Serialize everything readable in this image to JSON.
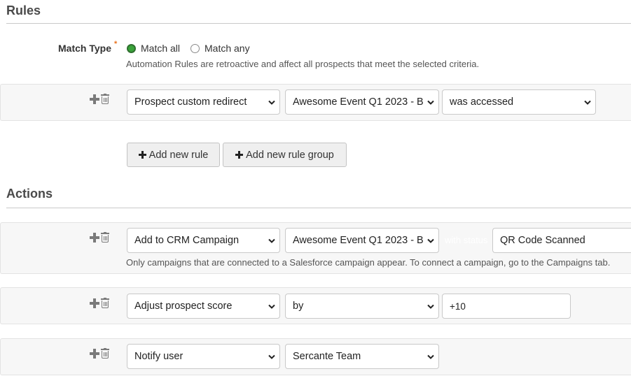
{
  "rules": {
    "title": "Rules",
    "match_type": {
      "label": "Match Type",
      "required_mark": "*",
      "options": [
        {
          "label": "Match all",
          "checked": true
        },
        {
          "label": "Match any",
          "checked": false
        }
      ],
      "help": "Automation Rules are retroactive and affect all prospects that meet the selected criteria."
    },
    "items": [
      {
        "criteria": "Prospect custom redirect",
        "target": "Awesome Event Q1 2023 - B",
        "condition": "was accessed"
      }
    ],
    "buttons": {
      "add_rule": "Add new rule",
      "add_rule_group": "Add new rule group"
    }
  },
  "actions": {
    "title": "Actions",
    "items": [
      {
        "action": "Add to CRM Campaign",
        "target": "Awesome Event Q1 2023 - B",
        "status_label": "with status",
        "status_value": "QR Code Scanned",
        "help": "Only campaigns that are connected to a Salesforce campaign appear. To connect a campaign, go to the Campaigns tab."
      },
      {
        "action": "Adjust prospect score",
        "operator": "by",
        "value": "+10"
      },
      {
        "action": "Notify user",
        "target": "Sercante Team"
      }
    ]
  },
  "icons": {
    "add": "plus-icon",
    "delete": "trash-icon",
    "dropdown": "chevron-down-icon"
  },
  "colors": {
    "radio_selected": "#3aa33a",
    "required_star": "#e9731e",
    "row_background": "#f7f7f7",
    "button_background": "#efefef"
  }
}
